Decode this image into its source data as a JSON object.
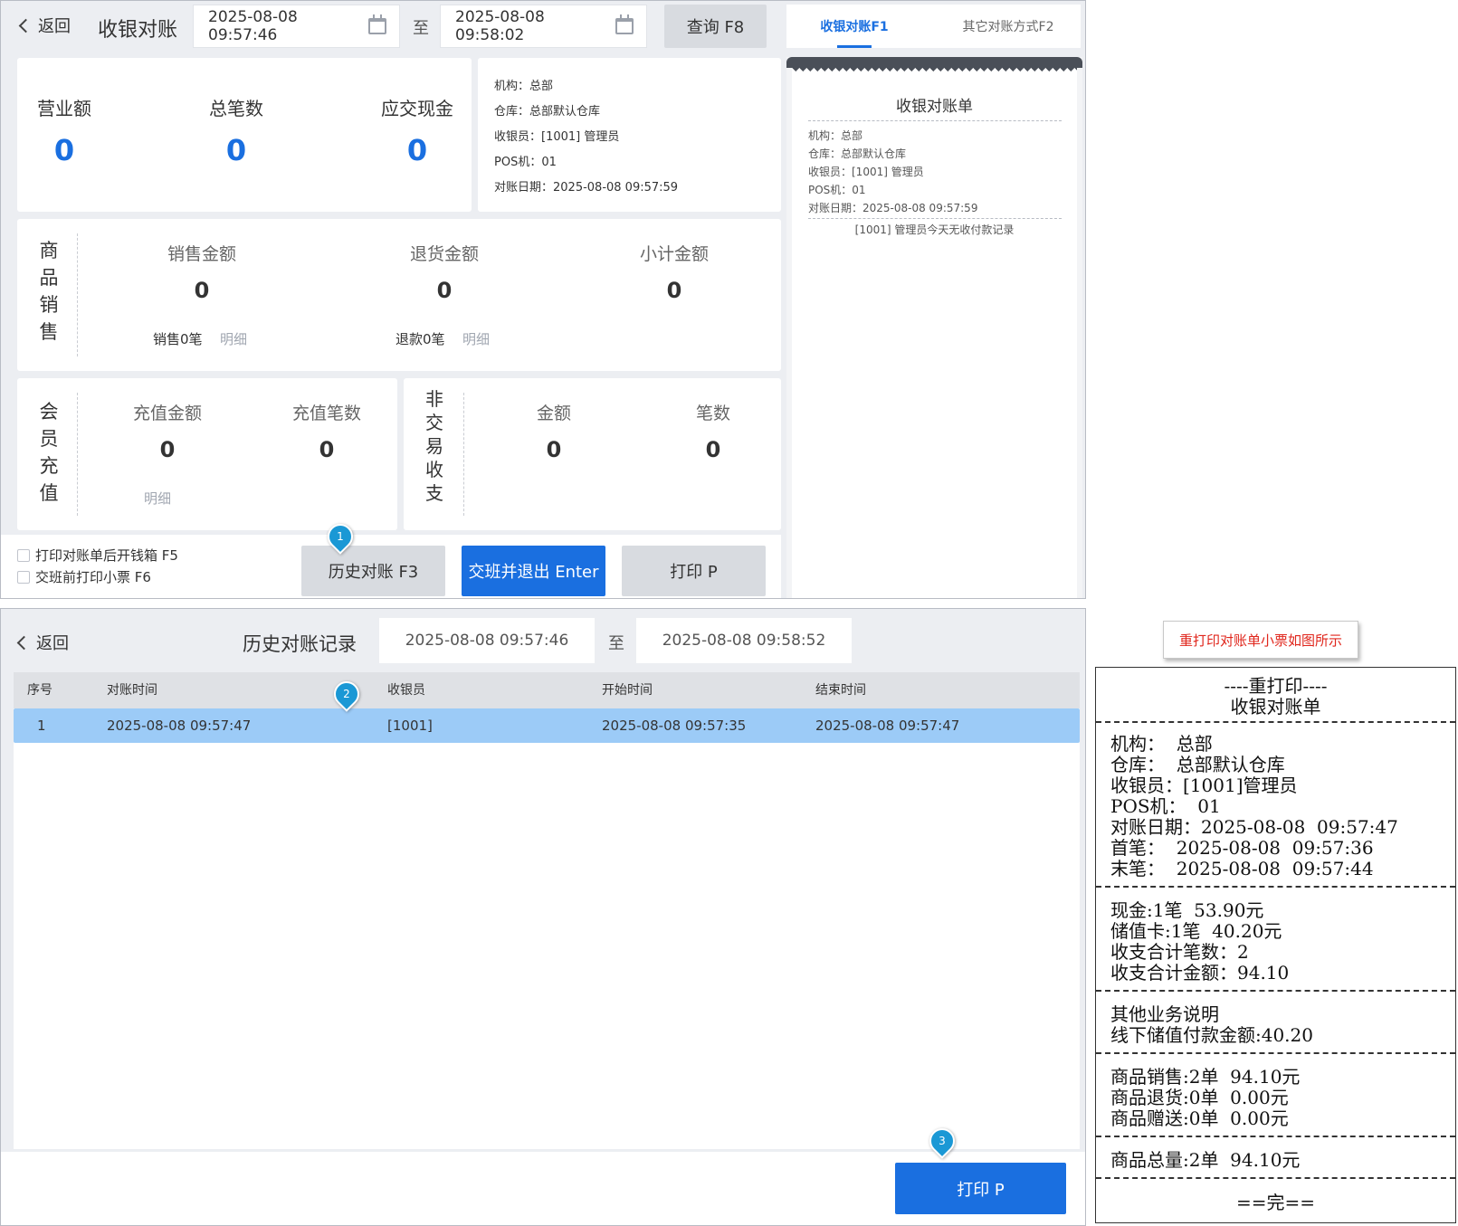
{
  "top": {
    "back": "返回",
    "title": "收银对账",
    "start_date": "2025-08-08 09:57:46",
    "to": "至",
    "end_date": "2025-08-08 09:58:02",
    "query_btn": "查询 F8",
    "tabs": [
      "收银对账F1",
      "其它对账方式F2"
    ],
    "stats": [
      {
        "label": "营业额",
        "value": "0"
      },
      {
        "label": "总笔数",
        "value": "0"
      },
      {
        "label": "应交现金",
        "value": "0"
      }
    ],
    "info": [
      "机构：总部",
      "仓库：总部默认仓库",
      "收银员：[1001] 管理员",
      "POS机：01",
      "对账日期：2025-08-08 09:57:59"
    ],
    "goods_sales": {
      "label": "商品销售",
      "cols": [
        {
          "label": "销售金额",
          "value": "0"
        },
        {
          "label": "退货金额",
          "value": "0"
        },
        {
          "label": "小计金额",
          "value": "0"
        }
      ],
      "sales_count": "销售0笔",
      "return_count": "退款0笔",
      "detail": "明细"
    },
    "member_recharge": {
      "label": "会员充值",
      "cols": [
        {
          "label": "充值金额",
          "value": "0"
        },
        {
          "label": "充值笔数",
          "value": "0"
        }
      ],
      "detail": "明细"
    },
    "non_trade": {
      "label": "非交易收支",
      "cols": [
        {
          "label": "金额",
          "value": "0"
        },
        {
          "label": "笔数",
          "value": "0"
        }
      ]
    },
    "checkboxes": [
      "打印对账单后开钱箱 F5",
      "交班前打印小票 F6"
    ],
    "history_btn": "历史对账 F3",
    "handover_btn": "交班并退出 Enter",
    "print_btn": "打印 P",
    "receipt_preview": {
      "title": "收银对账单",
      "lines": [
        "机构：总部",
        "仓库：总部默认仓库",
        "收银员：[1001] 管理员",
        "POS机：01",
        "对账日期：2025-08-08 09:57:59"
      ],
      "note": "[1001] 管理员今天无收付款记录"
    }
  },
  "markers": [
    "1",
    "2",
    "3"
  ],
  "history": {
    "back": "返回",
    "title": "历史对账记录",
    "start_date": "2025-08-08 09:57:46",
    "to": "至",
    "end_date": "2025-08-08 09:58:52",
    "columns": [
      "序号",
      "对账时间",
      "收银员",
      "开始时间",
      "结束时间"
    ],
    "rows": [
      [
        "1",
        "2025-08-08 09:57:47",
        "[1001]",
        "2025-08-08 09:57:35",
        "2025-08-08 09:57:47"
      ]
    ],
    "print_btn": "打印 P"
  },
  "callout": "重打印对账单小票如图所示",
  "ticket": {
    "header": "----重打印----",
    "title": "收银对账单",
    "sections": [
      [
        "机构：  总部",
        "仓库：  总部默认仓库",
        "收银员：[1001]管理员",
        "POS机：  01",
        "对账日期：2025-08-08  09:57:47",
        "首笔：  2025-08-08  09:57:36",
        "末笔：  2025-08-08  09:57:44"
      ],
      [
        "现金:1笔  53.90元",
        "储值卡:1笔  40.20元",
        "收支合计笔数：2",
        "收支合计金额：94.10"
      ],
      [
        "其他业务说明",
        "线下储值付款金额:40.20"
      ],
      [
        "商品销售:2单  94.10元",
        "商品退货:0单  0.00元",
        "商品赠送:0单  0.00元"
      ],
      [
        "商品总量:2单  94.10元"
      ]
    ],
    "end": "==完=="
  }
}
